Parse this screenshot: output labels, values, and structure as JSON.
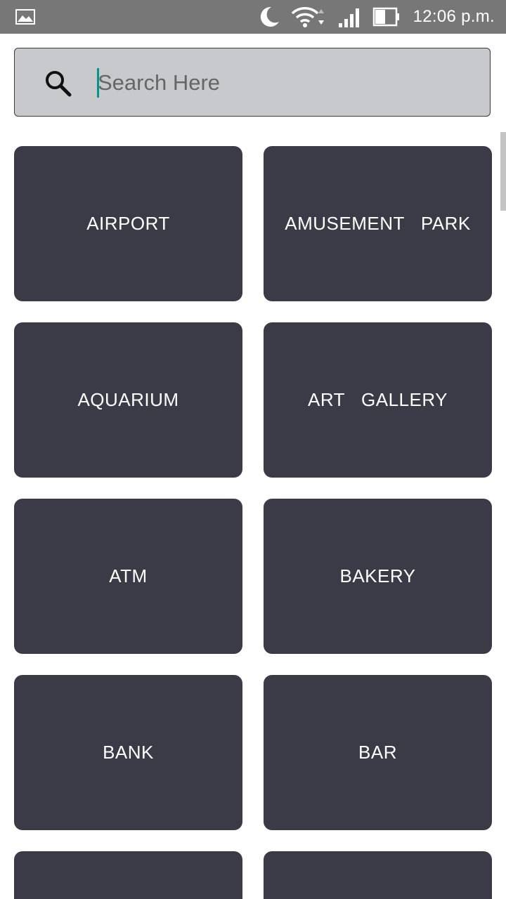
{
  "status_bar": {
    "time": "12:06 p.m.",
    "icons": [
      "gallery-icon",
      "moon-icon",
      "wifi-icon",
      "signal-icon",
      "battery-icon"
    ]
  },
  "search": {
    "placeholder": "Search Here",
    "value": "",
    "icon": "search-icon"
  },
  "categories": [
    "AIRPORT",
    "AMUSEMENT  PARK",
    "AQUARIUM",
    "ART  GALLERY",
    "ATM",
    "BAKERY",
    "BANK",
    "BAR",
    "",
    ""
  ],
  "colors": {
    "status_bar": "#777777",
    "search_bg": "#c8c9cc",
    "tile_bg": "#3b3a47",
    "tile_text": "#ffffff",
    "caret": "#009688"
  }
}
